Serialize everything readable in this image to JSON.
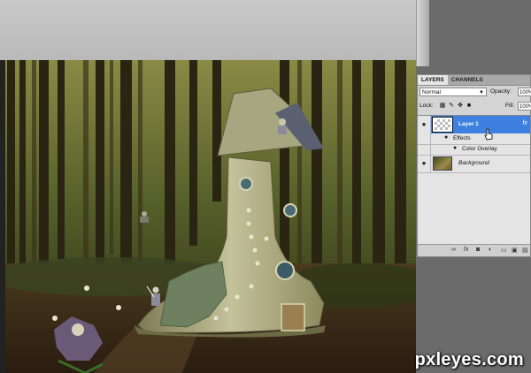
{
  "layers_panel": {
    "tabs": [
      "LAYERS",
      "CHANNELS"
    ],
    "blend_mode": "Normal",
    "opacity_label": "Opacity:",
    "opacity_value": "100%",
    "lock_label": "Lock:",
    "fill_label": "Fill:",
    "fill_value": "100%",
    "layers": [
      {
        "name": "Layer 1",
        "selected": true,
        "has_effects": true
      },
      {
        "name": "Effects",
        "type": "effects-header"
      },
      {
        "name": "Color Overlay",
        "type": "effect"
      },
      {
        "name": "Background",
        "italic": true
      }
    ]
  },
  "watermark": "pxleyes.com",
  "colors": {
    "selection": "#3d80e0",
    "panel_bg": "#d4d4d4",
    "workspace": "#6b6b6b"
  }
}
